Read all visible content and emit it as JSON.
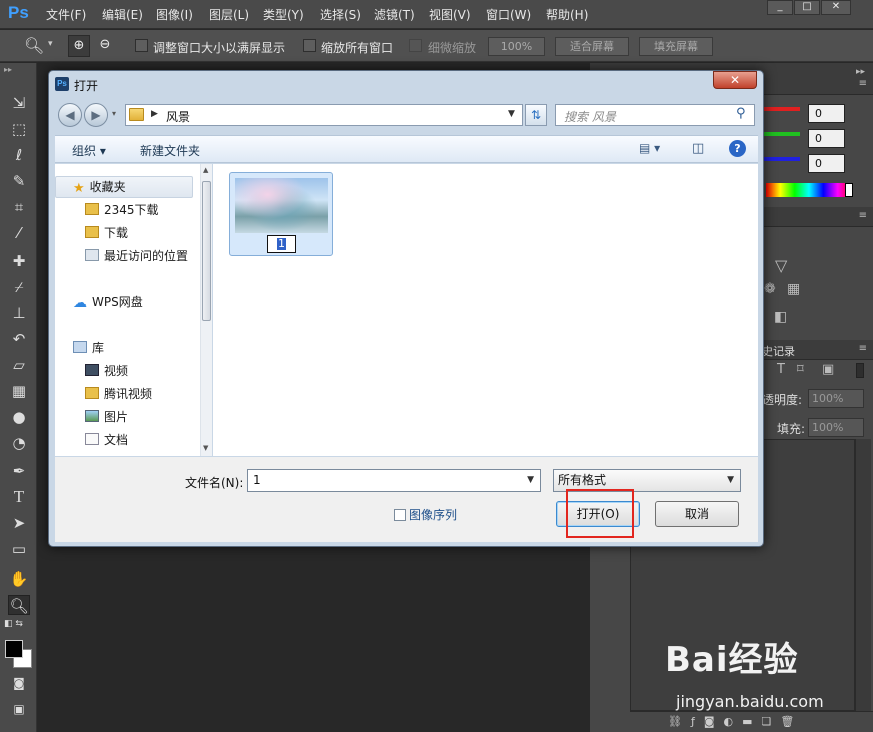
{
  "app": {
    "logo": "Ps",
    "menu": [
      "文件(F)",
      "编辑(E)",
      "图像(I)",
      "图层(L)",
      "类型(Y)",
      "选择(S)",
      "滤镜(T)",
      "视图(V)",
      "窗口(W)",
      "帮助(H)"
    ],
    "window_buttons": [
      "_",
      "□",
      "✕"
    ]
  },
  "options": {
    "resize_windows": "调整窗口大小以满屏显示",
    "zoom_all": "缩放所有窗口",
    "scrubby_zoom": "细微缩放",
    "zoom_percent": "100%",
    "fit_screen": "适合屏幕",
    "fill_screen": "填充屏幕"
  },
  "panels": {
    "color_values": [
      "0",
      "0",
      "0"
    ],
    "history_tab": "史记录",
    "opacity_label": "透明度:",
    "opacity_value": "100%",
    "fill_label": "填充:",
    "fill_value": "100%"
  },
  "dialog": {
    "title": "打开",
    "close": "✕",
    "breadcrumb": "风景",
    "search_placeholder": "搜索 风景",
    "organize": "组织 ▾",
    "new_folder": "新建文件夹",
    "nav": {
      "favorites": "收藏夹",
      "favorite_items": [
        "2345下载",
        "下载",
        "最近访问的位置"
      ],
      "wps": "WPS网盘",
      "library": "库",
      "library_items": [
        "视频",
        "腾讯视频",
        "图片",
        "文档"
      ]
    },
    "file": {
      "name": "1"
    },
    "filename_label": "文件名(N):",
    "filename_value": "1",
    "format_value": "所有格式",
    "image_sequence": "图像序列",
    "open_button": "打开(O)",
    "cancel_button": "取消"
  },
  "watermark": {
    "brand": "Bai经验",
    "url": "jingyan.baidu.com"
  },
  "colors": {
    "accent_blue": "#3062c8",
    "highlight_red": "#e2261f",
    "ps_blue": "#40a0ff"
  }
}
